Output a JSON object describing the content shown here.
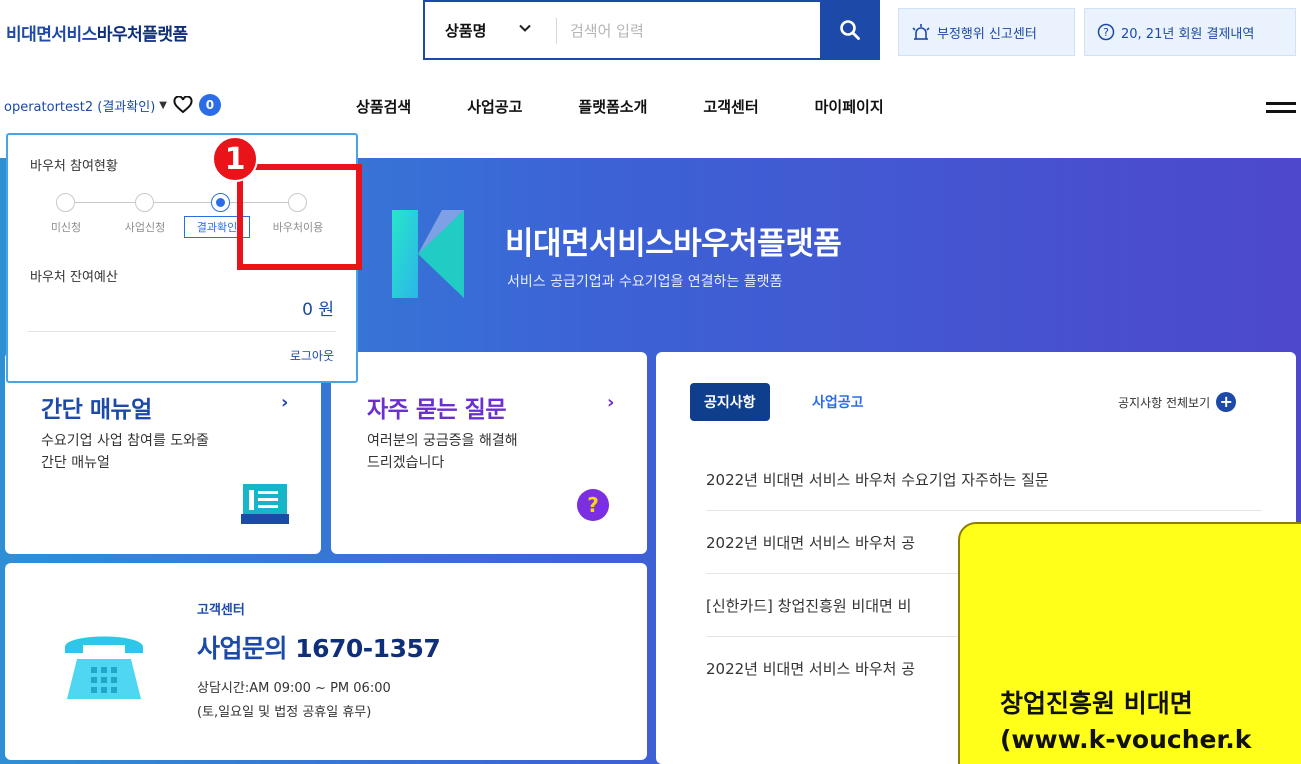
{
  "header": {
    "logo_main": "비대면서비스",
    "logo_accent": "바우처플랫폼",
    "search": {
      "category": "상품명",
      "placeholder": "검색어 입력"
    },
    "report_label": "부정행위 신고센터",
    "payment_label": "20, 21년 회원 결제내역"
  },
  "user": {
    "name": "operatortest2 (결과확인)",
    "wishlist_count": "0"
  },
  "nav": {
    "items": [
      "상품검색",
      "사업공고",
      "플랫폼소개",
      "고객센터",
      "마이페이지"
    ]
  },
  "hero": {
    "title": "비대면서비스바우처플랫폼",
    "subtitle": "서비스 공급기업과 수요기업을 연결하는 플랫폼"
  },
  "voucher_panel": {
    "title": "바우처 참여현황",
    "steps": [
      "미신청",
      "사업신청",
      "결과확인",
      "바우처이용"
    ],
    "active_step": 2,
    "budget_title": "바우처 잔여예산",
    "amount": "0 원",
    "logout": "로그아웃"
  },
  "annotation": {
    "number": "1",
    "color": "#e8141a"
  },
  "cards": {
    "manual": {
      "title": "간단 매뉴얼",
      "desc_line1": "수요기업 사업 참여를 도와줄",
      "desc_line2": "간단 매뉴얼",
      "arrow": "›"
    },
    "faq": {
      "title": "자주 묻는 질문",
      "desc_line1": "여러분의 궁금증을 해결해",
      "desc_line2": "드리겠습니다",
      "arrow": "›"
    },
    "support": {
      "small": "고객센터",
      "phone_label": "사업문의 ",
      "phone_number": "1670-1357",
      "hours_line1": "상담시간:AM 09:00 ~ PM 06:00",
      "hours_line2": "(토,일요일 및 법정 공휴일 휴무)"
    }
  },
  "notice": {
    "tab_active": "공지사항",
    "tab_inactive": "사업공고",
    "view_all": "공지사항 전체보기",
    "items": [
      "2022년 비대면 서비스 바우처 수요기업 자주하는 질문",
      "2022년 비대면 서비스 바우처 공",
      "[신한카드] 창업진흥원 비대면 비",
      "2022년 비대면 서비스 바우처 공"
    ]
  },
  "callout": {
    "line1": "창업진흥원 비대면",
    "line2": "(www.k-voucher.k"
  },
  "colors": {
    "brand_blue": "#1d4aa8",
    "accent_blue": "#2b6de6",
    "faq_purple": "#6b2fd1",
    "callout_yellow": "#ffff1a"
  },
  "icons": [
    "search-icon",
    "chevron-down-icon",
    "siren-icon",
    "question-circle-icon",
    "heart-icon",
    "menu-icon",
    "book-icon",
    "question-icon",
    "telephone-icon",
    "plus-icon"
  ]
}
